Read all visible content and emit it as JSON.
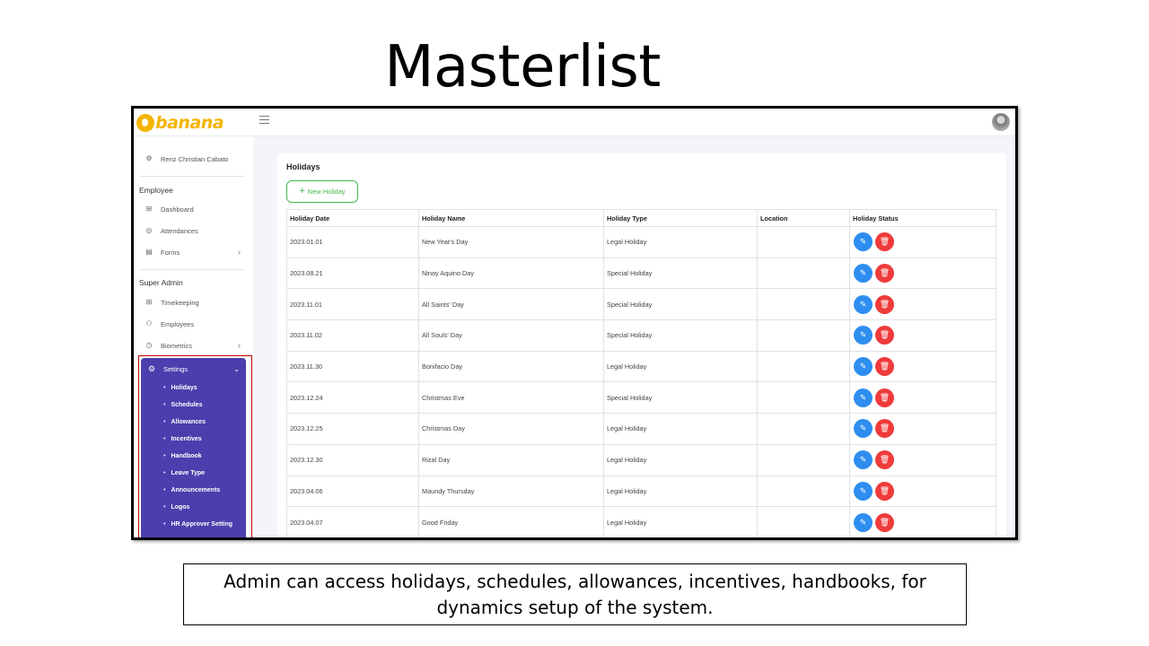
{
  "slide": {
    "title": "Masterlist",
    "caption": "Admin can access holidays, schedules, allowances, incentives, handbooks, for dynamics setup of the system."
  },
  "app": {
    "logo_text": "banana",
    "brand_color": "#f5b400",
    "accent_color": "#4a3fad"
  },
  "sidebar": {
    "user_name": "Renz Christian Cabato",
    "employee_section": "Employee",
    "employee_items": [
      {
        "label": "Dashboard",
        "icon": "grid-icon"
      },
      {
        "label": "Attendances",
        "icon": "watch-icon"
      },
      {
        "label": "Forms",
        "icon": "form-icon",
        "has_children": true
      }
    ],
    "admin_section": "Super Admin",
    "admin_items": [
      {
        "label": "Timekeeping",
        "icon": "grid-icon"
      },
      {
        "label": "Employees",
        "icon": "user-icon"
      },
      {
        "label": "Biometrics",
        "icon": "clock-icon",
        "has_children": true
      }
    ],
    "settings": {
      "label": "Settings",
      "expanded": true,
      "items": [
        "Holidays",
        "Schedules",
        "Allowances",
        "Incentives",
        "Handbook",
        "Leave Type",
        "Announcements",
        "Logos",
        "HR Approver Setting"
      ]
    }
  },
  "main": {
    "title": "Holidays",
    "new_button": "New Holiday",
    "columns": [
      "Holiday Date",
      "Holiday Name",
      "Holiday Type",
      "Location",
      "Holiday Status"
    ],
    "rows": [
      {
        "date": "2023.01.01",
        "name": "New Year's Day",
        "type": "Legal Holiday",
        "location": ""
      },
      {
        "date": "2023.08.21",
        "name": "Ninoy Aquino Day",
        "type": "Special Holiday",
        "location": ""
      },
      {
        "date": "2023.11.01",
        "name": "All Saints' Day",
        "type": "Special Holiday",
        "location": ""
      },
      {
        "date": "2023.11.02",
        "name": "All Souls' Day",
        "type": "Special Holiday",
        "location": ""
      },
      {
        "date": "2023.11.30",
        "name": "Bonifacio Day",
        "type": "Legal Holiday",
        "location": ""
      },
      {
        "date": "2023.12.24",
        "name": "Christmas Eve",
        "type": "Special Holiday",
        "location": ""
      },
      {
        "date": "2023.12.25",
        "name": "Christmas Day",
        "type": "Legal Holiday",
        "location": ""
      },
      {
        "date": "2023.12.30",
        "name": "Rizal Day",
        "type": "Legal Holiday",
        "location": ""
      },
      {
        "date": "2023.04.06",
        "name": "Maundy Thursday",
        "type": "Legal Holiday",
        "location": ""
      },
      {
        "date": "2023.04.07",
        "name": "Good Friday",
        "type": "Legal Holiday",
        "location": ""
      }
    ]
  }
}
